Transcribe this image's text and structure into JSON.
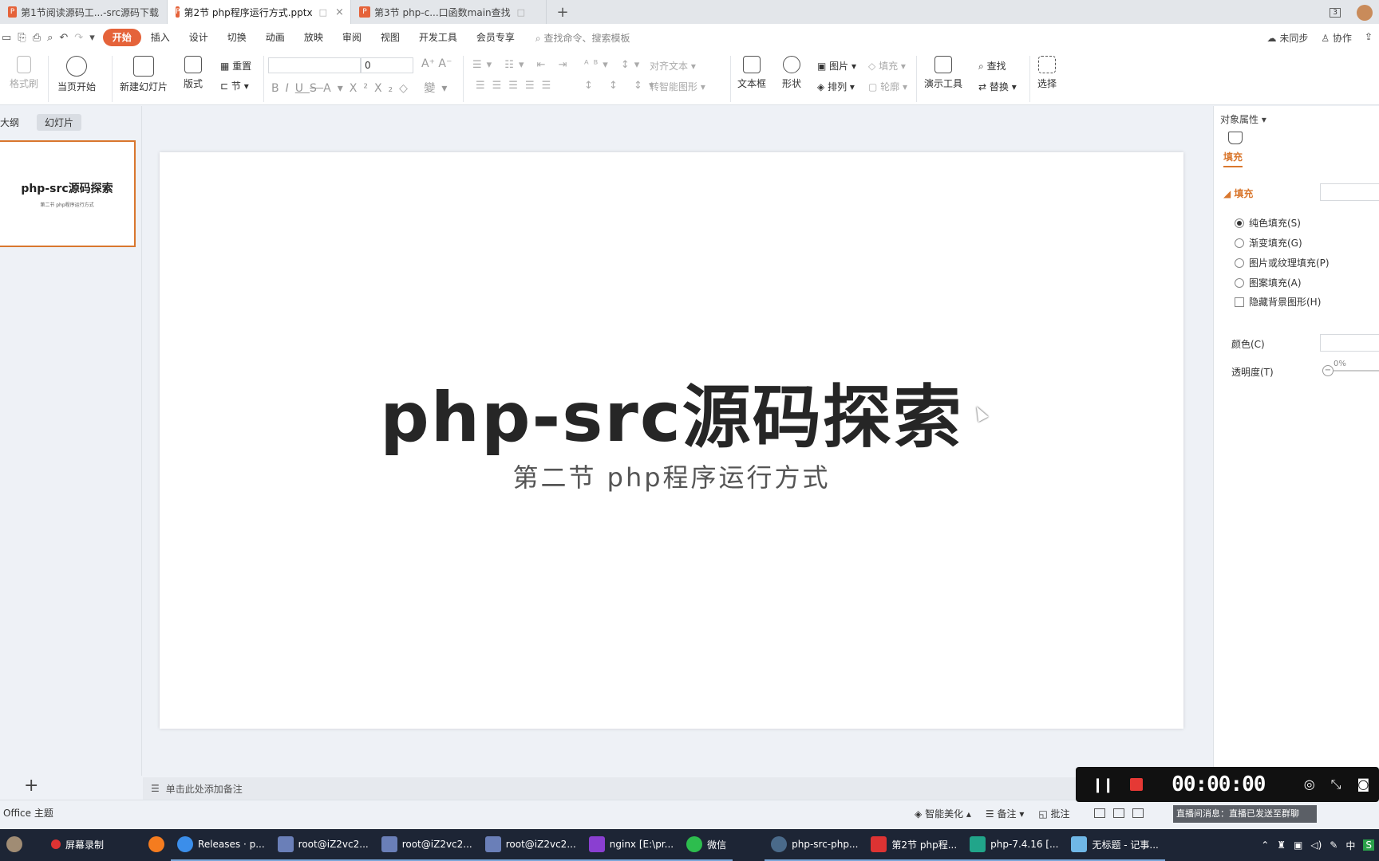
{
  "tabs": [
    {
      "label": "第1节阅读源码工...-src源码下载",
      "active": false
    },
    {
      "label": "第2节 php程序运行方式.pptx",
      "active": true
    },
    {
      "label": "第3节 php-c...口函数main查找",
      "active": false
    }
  ],
  "tabbar_right": {
    "window_count": "3"
  },
  "menu": {
    "items": [
      "开始",
      "插入",
      "设计",
      "切换",
      "动画",
      "放映",
      "审阅",
      "视图",
      "开发工具",
      "会员专享"
    ],
    "search": "查找命令、搜索模板",
    "sync": "未同步",
    "collab": "协作"
  },
  "ribbon": {
    "format_painter": "格式刷",
    "from_current": "当页开始",
    "new_slide": "新建幻灯片",
    "layout": "版式",
    "reset": "重置",
    "section": "节",
    "font_size": "0",
    "align_text": "对齐文本",
    "smart_art": "转智能图形",
    "textbox": "文本框",
    "shape": "形状",
    "picture": "图片",
    "arrange": "排列",
    "fill": "填充",
    "outline": "轮廓",
    "present_tools": "演示工具",
    "find": "查找",
    "replace": "替换",
    "select": "选择"
  },
  "left_panel": {
    "tab_outline": "大纲",
    "tab_slides": "幻灯片",
    "thumb_title": "php-src源码探索",
    "thumb_subtitle": "第二节 php程序运行方式",
    "add": "+"
  },
  "slide": {
    "title": "php-src源码探索",
    "subtitle": "第二节 php程序运行方式"
  },
  "notes": {
    "placeholder": "单击此处添加备注"
  },
  "right_panel": {
    "title": "对象属性",
    "fill_tab": "填充",
    "section": "填充",
    "options": [
      "纯色填充(S)",
      "渐变填充(G)",
      "图片或纹理填充(P)",
      "图案填充(A)"
    ],
    "hide_bg": "隐藏背景图形(H)",
    "color_label": "颜色(C)",
    "transparency_label": "透明度(T)",
    "transparency_value": "0%"
  },
  "statusbar": {
    "theme": "Office 主题",
    "beautify": "智能美化",
    "notes": "备注",
    "comments": "批注"
  },
  "recorder": {
    "time": "00:00:00",
    "live_message": "直播间消息：直播已发送至群聊"
  },
  "taskbar": {
    "items": [
      "屏幕录制",
      "Releases · p...",
      "root@iZ2vc2...",
      "root@iZ2vc2...",
      "root@iZ2vc2...",
      "nginx [E:\\pr...",
      "微信",
      "php-src-php...",
      "第2节 php程...",
      "php-7.4.16 [...",
      "无标题 - 记事..."
    ],
    "tray_lang": "中"
  },
  "colors": {
    "accent": "#e5633a",
    "selection": "#d9772e",
    "taskbar": "#1d2535"
  }
}
